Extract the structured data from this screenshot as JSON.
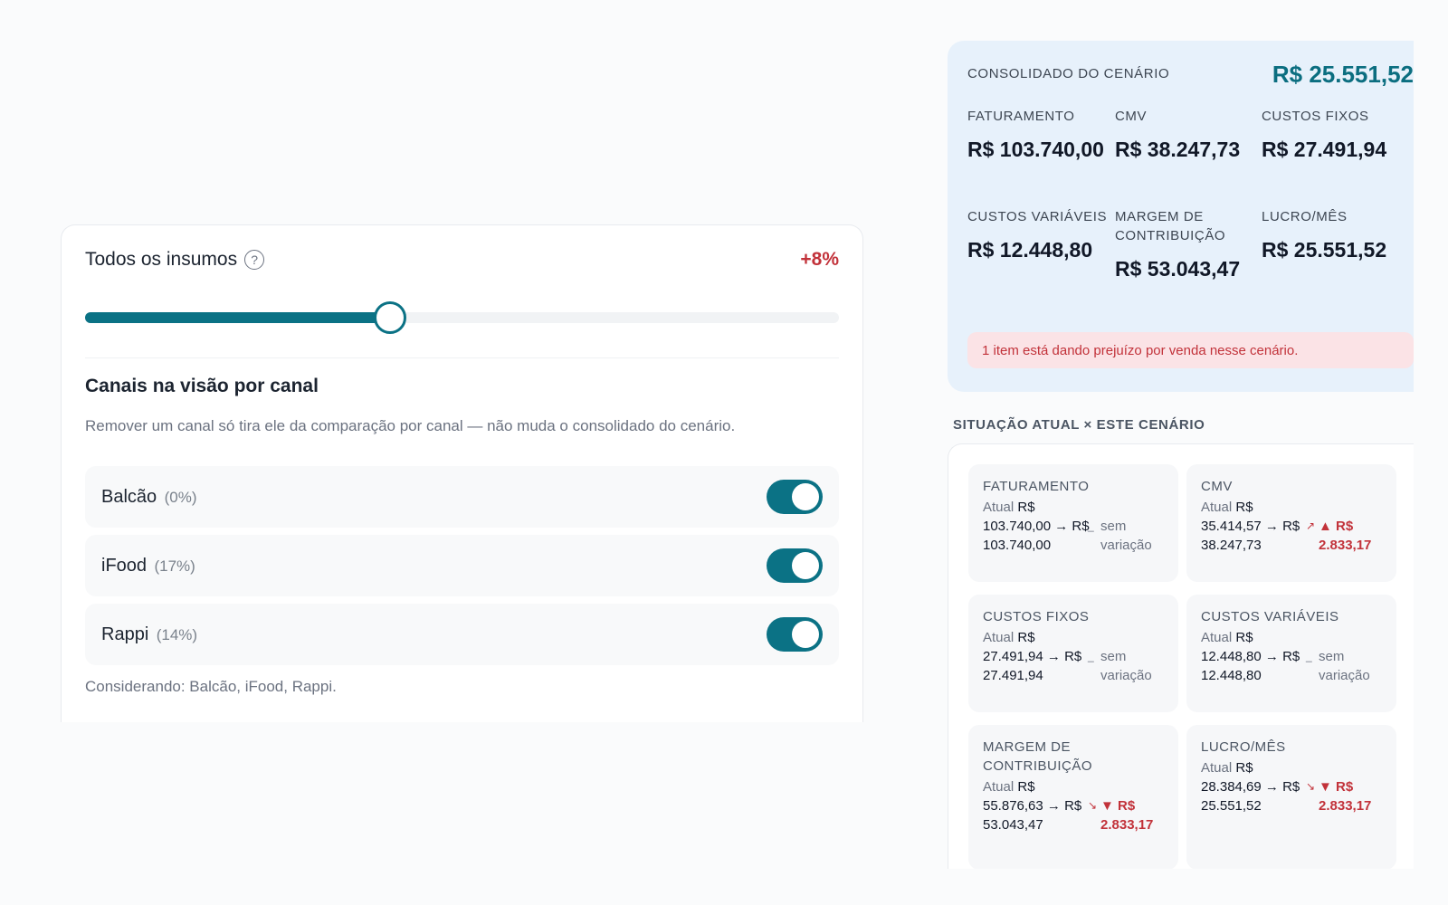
{
  "simulator": {
    "ingredients_label": "Todos os insumos",
    "ingredients_pct": "+8%",
    "slider_level": 0.405,
    "channels_title": "Canais na visão por canal",
    "channels_description": "Remover um canal só tira ele da comparação por canal — não muda o consolidado do cenário.",
    "channels": [
      {
        "label": "Balcão",
        "pct": "(0%)",
        "enabled": true
      },
      {
        "label": "iFood",
        "pct": "(17%)",
        "enabled": true
      },
      {
        "label": "Rappi",
        "pct": "(14%)",
        "enabled": true
      }
    ],
    "considering": "Considerando: Balcão, iFood, Rappi."
  },
  "consolidated": {
    "header": "CONSOLIDADO DO CENÁRIO",
    "total": "R$ 25.551,52",
    "metrics": [
      {
        "label": "FATURAMENTO",
        "value": "R$ 103.740,00"
      },
      {
        "label": "CMV",
        "value": "R$ 38.247,73"
      },
      {
        "label": "CUSTOS FIXOS",
        "value": "R$ 27.491,94"
      },
      {
        "label": "CUSTOS VARIÁVEIS",
        "value": "R$ 12.448,80"
      },
      {
        "label": "MARGEM DE CONTRIBUIÇÃO",
        "value": "R$ 53.043,47"
      },
      {
        "label": "LUCRO/MÊS",
        "value": "R$ 25.551,52"
      }
    ],
    "alert": "1 item está dando prejuízo por venda nesse cenário."
  },
  "comparison": {
    "header": "SITUAÇÃO ATUAL × ESTE CENÁRIO",
    "tiles": [
      {
        "label": "FATURAMENTO",
        "current_prefix": "Atual",
        "current": "R$ 103.740,00",
        "arrow": "→",
        "scenario": "R$ 103.740,00",
        "delta": "sem variação",
        "trend": "flat",
        "trend_icon": "_"
      },
      {
        "label": "CMV",
        "current_prefix": "Atual",
        "current": "R$ 35.414,57",
        "arrow": "→",
        "scenario": "R$ 38.247,73",
        "delta": "▲ R$ 2.833,17",
        "trend": "up",
        "trend_icon": "↗"
      },
      {
        "label": "CUSTOS FIXOS",
        "current_prefix": "Atual",
        "current": "R$ 27.491,94",
        "arrow": "→",
        "scenario": "R$ 27.491,94",
        "delta": "sem variação",
        "trend": "flat",
        "trend_icon": "_"
      },
      {
        "label": "CUSTOS VARIÁVEIS",
        "current_prefix": "Atual",
        "current": "R$ 12.448,80",
        "arrow": "→",
        "scenario": "R$ 12.448,80",
        "delta": "sem variação",
        "trend": "flat",
        "trend_icon": "_"
      },
      {
        "label": "MARGEM DE CONTRIBUIÇÃO",
        "current_prefix": "Atual",
        "current": "R$ 55.876,63",
        "arrow": "→",
        "scenario": "R$ 53.043,47",
        "delta": "▼ R$ 2.833,17",
        "trend": "down",
        "trend_icon": "↘"
      },
      {
        "label": "LUCRO/MÊS",
        "current_prefix": "Atual",
        "current": "R$ 28.384,69",
        "arrow": "→",
        "scenario": "R$ 25.551,52",
        "delta": "▼ R$ 2.833,17",
        "trend": "down",
        "trend_icon": "↘"
      }
    ]
  }
}
